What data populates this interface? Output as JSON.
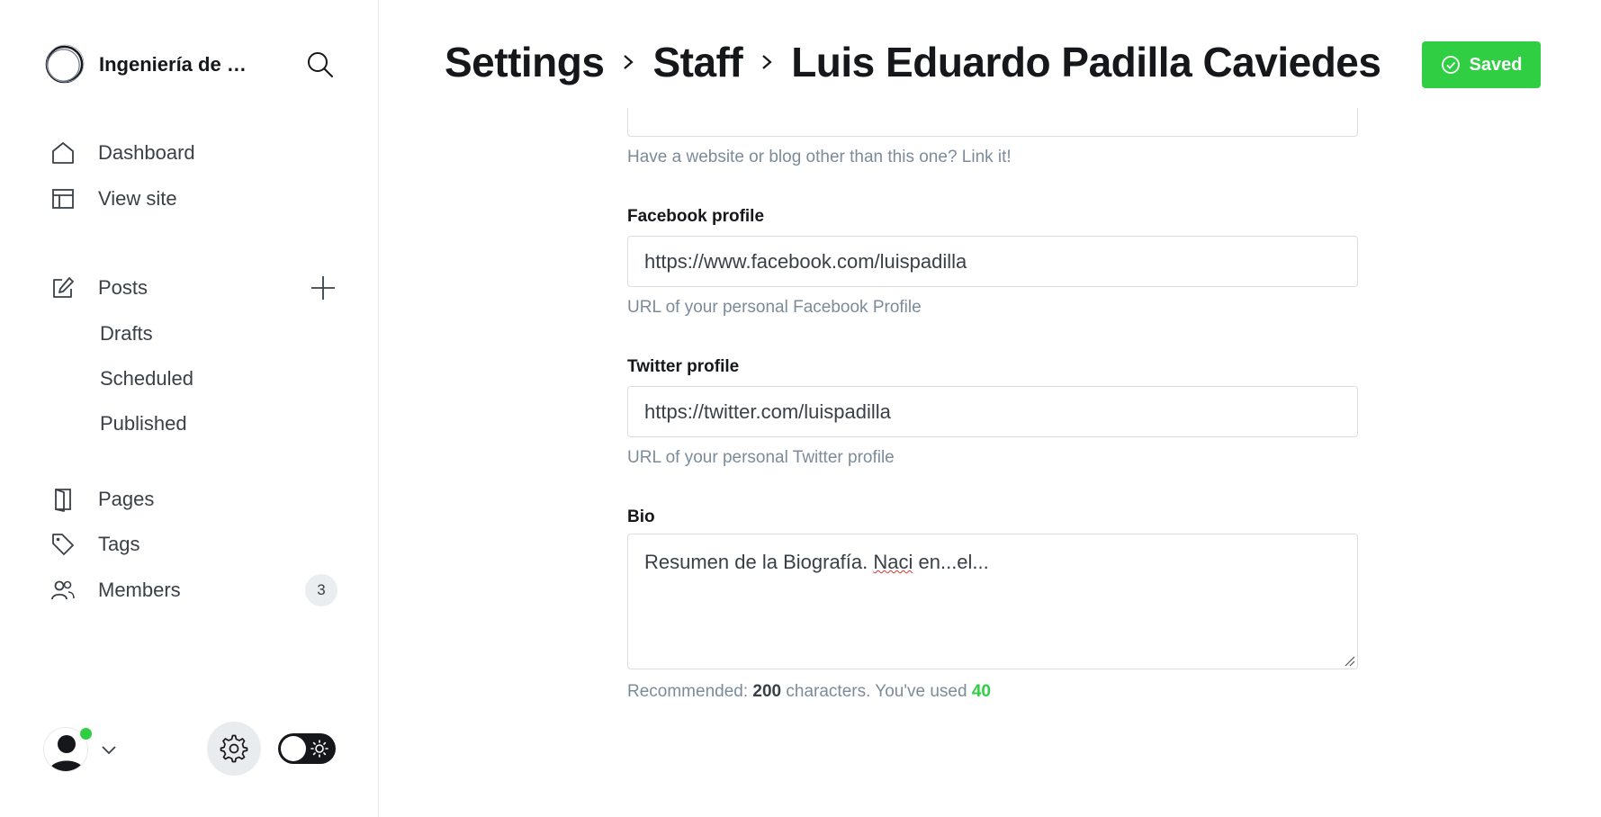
{
  "sidebar": {
    "brand_name": "Ingeniería de So...",
    "nav": {
      "dashboard": "Dashboard",
      "view_site": "View site",
      "posts": "Posts",
      "drafts": "Drafts",
      "scheduled": "Scheduled",
      "published": "Published",
      "pages": "Pages",
      "tags": "Tags",
      "members": "Members",
      "members_count": "3"
    }
  },
  "header": {
    "breadcrumb": [
      "Settings",
      "Staff",
      "Luis Eduardo Padilla Caviedes"
    ],
    "saved_label": "Saved"
  },
  "form": {
    "website_hint": "Have a website or blog other than this one? Link it!",
    "facebook": {
      "label": "Facebook profile",
      "value": "https://www.facebook.com/luispadilla",
      "hint": "URL of your personal Facebook Profile"
    },
    "twitter": {
      "label": "Twitter profile",
      "value": "https://twitter.com/luispadilla",
      "hint": "URL of your personal Twitter profile"
    },
    "bio": {
      "label": "Bio",
      "value_before": "Resumen de la Biografía. ",
      "value_misspelled": "Naci",
      "value_after": " en...el...",
      "hint_prefix": "Recommended: ",
      "hint_recommended": "200",
      "hint_middle": " characters. You've used ",
      "hint_used": "40"
    }
  },
  "colors": {
    "accent_green": "#30cf43",
    "text_dark": "#15171a",
    "hint_gray": "#7c8b9a"
  }
}
